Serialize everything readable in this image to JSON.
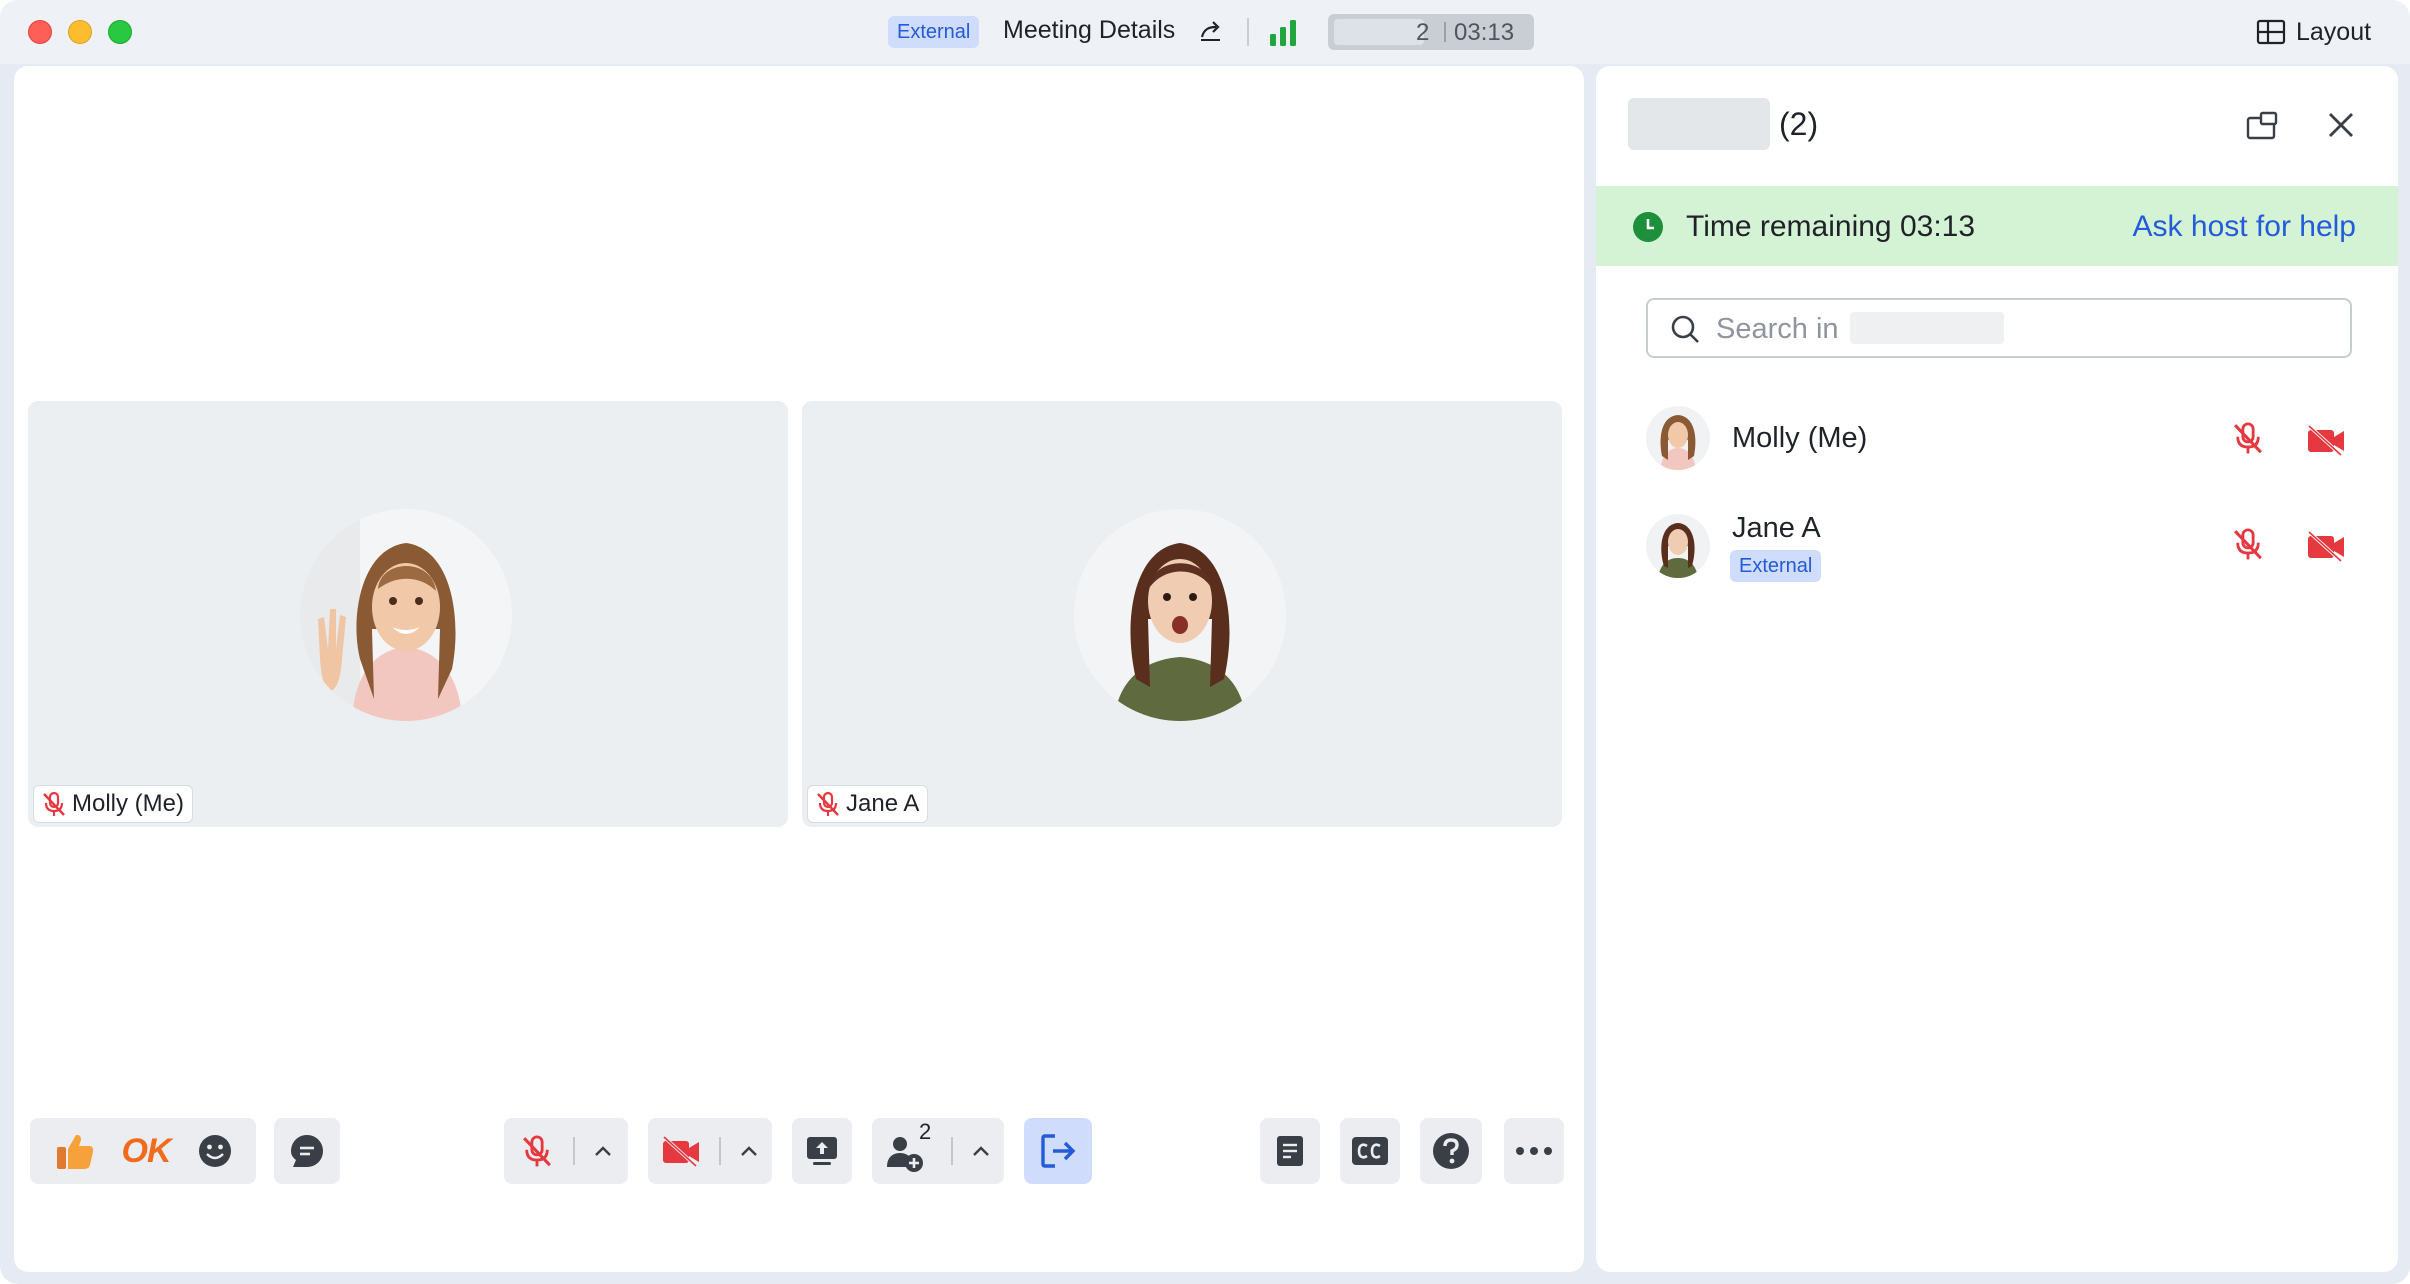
{
  "titlebar": {
    "badge": "External",
    "title": "Meeting Details",
    "participant_count": "2",
    "timer": "03:13",
    "layout_label": "Layout"
  },
  "stage": {
    "tiles": [
      {
        "name": "Molly (Me)"
      },
      {
        "name": "Jane A"
      }
    ]
  },
  "toolbar": {
    "ok_reaction": "OK",
    "participants_count": "2"
  },
  "panel": {
    "count": "(2)",
    "time_remaining": "Time remaining 03:13",
    "ask_help": "Ask host for help",
    "search_placeholder": "Search in",
    "participants": [
      {
        "name": "Molly (Me)",
        "tag": ""
      },
      {
        "name": "Jane A",
        "tag": "External"
      }
    ]
  },
  "colors": {
    "accent": "#245bdb",
    "muted_red": "#e5393f",
    "banner_green": "#d4f3d4",
    "clock_green": "#1e8f3a"
  }
}
